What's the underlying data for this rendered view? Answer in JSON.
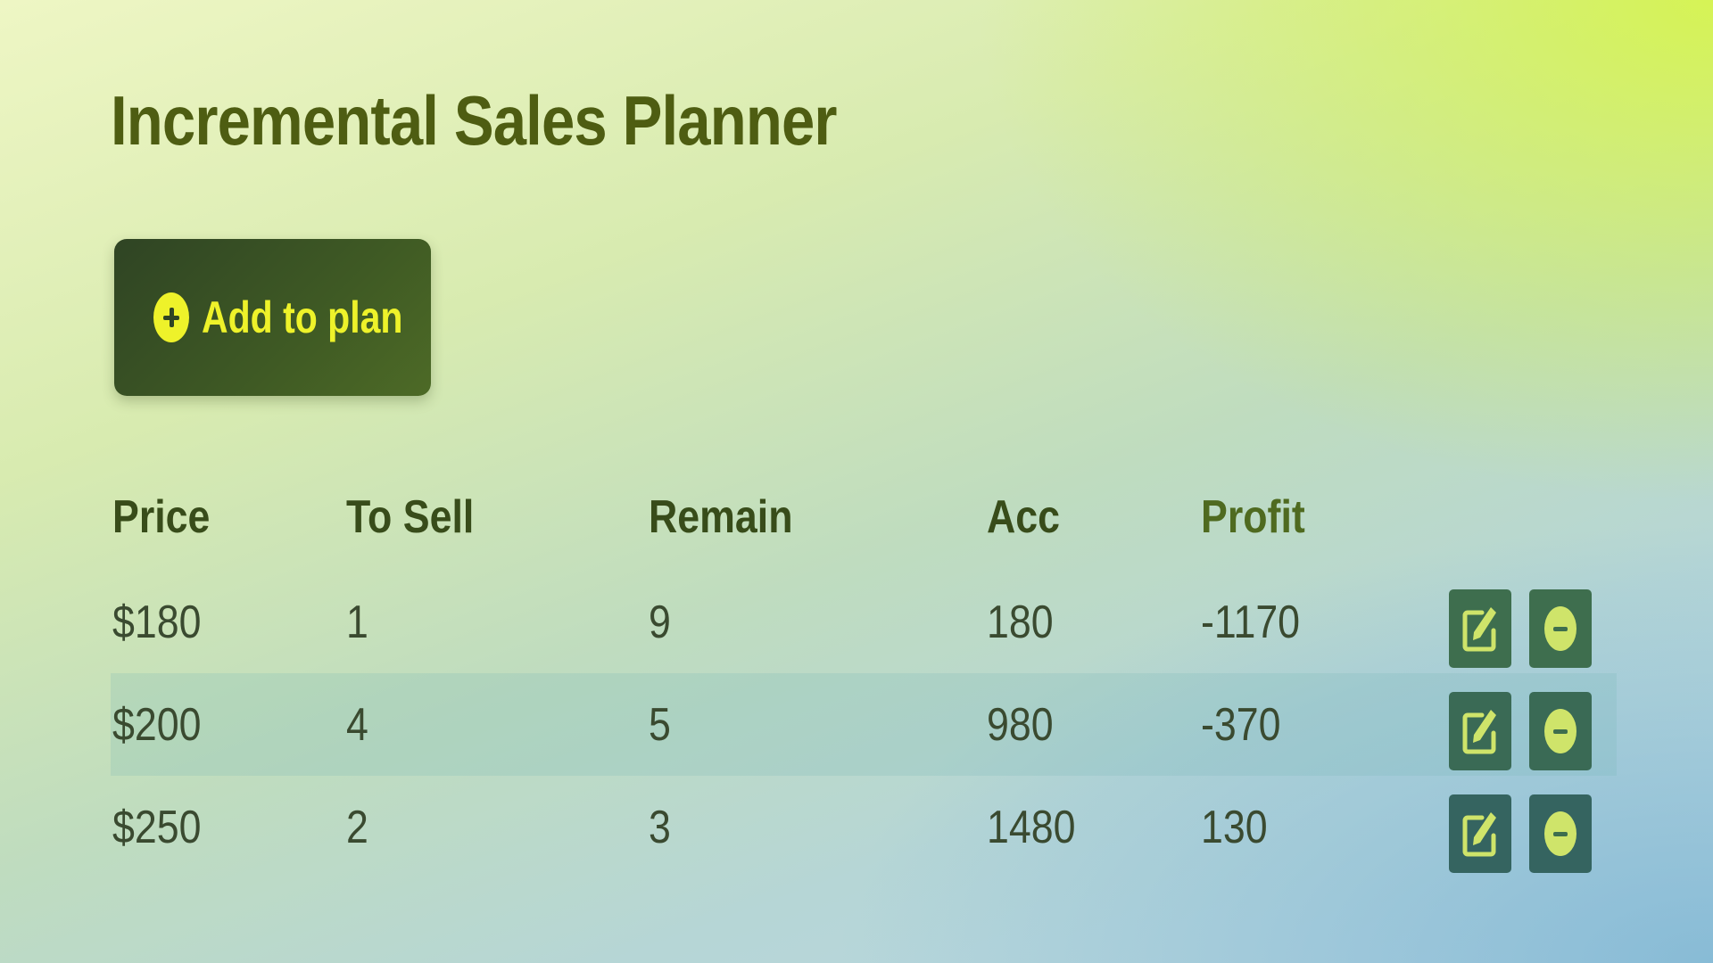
{
  "header": {
    "title": "Incremental Sales Planner"
  },
  "toolbar": {
    "add_label": "Add to plan",
    "add_icon": "plus-circle-icon"
  },
  "table": {
    "columns": [
      "Price",
      "To Sell",
      "Remain",
      "Acc",
      "Profit"
    ],
    "rows": [
      {
        "price": "$180",
        "to_sell": "1",
        "remain": "9",
        "acc": "180",
        "profit": "-1170"
      },
      {
        "price": "$200",
        "to_sell": "4",
        "remain": "5",
        "acc": "980",
        "profit": "-370"
      },
      {
        "price": "$250",
        "to_sell": "2",
        "remain": "3",
        "acc": "1480",
        "profit": "130"
      }
    ],
    "row_actions": [
      "edit-icon",
      "minus-circle-icon"
    ]
  },
  "colors": {
    "title": "#4e5d12",
    "button_bg": "#3f5a24",
    "button_text": "#eef22a",
    "action_bg": "#3e6e4e",
    "action_icon": "#cfe46a"
  }
}
